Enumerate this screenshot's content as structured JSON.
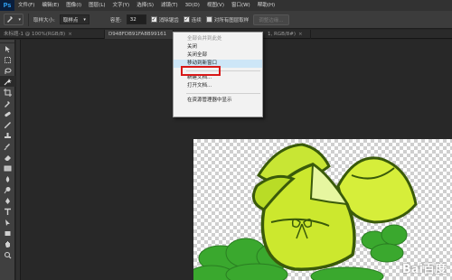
{
  "app": {
    "logo": "Ps"
  },
  "menu": [
    "文件(F)",
    "编辑(E)",
    "图像(I)",
    "图层(L)",
    "文字(Y)",
    "选择(S)",
    "滤镜(T)",
    "3D(D)",
    "视图(V)",
    "窗口(W)",
    "帮助(H)"
  ],
  "options": {
    "sample_size_label": "取样大小:",
    "sample_size_value": "取样点",
    "tolerance_label": "容差:",
    "tolerance_value": "32",
    "antialias_label": "消除锯齿",
    "antialias_checked": true,
    "contiguous_label": "连续",
    "contiguous_checked": true,
    "sample_all_label": "对所有图层取样",
    "sample_all_checked": false,
    "refine_edge_button": "调整边缘..."
  },
  "tabs": [
    {
      "label": "未标题-1 @ 100%(RGB/8)",
      "active": false,
      "close": "×"
    },
    {
      "label": "D948FDB91FA8B99161",
      "active": true,
      "close": ""
    },
    {
      "label": "1, RGB/8#)",
      "active": false,
      "close": "×"
    }
  ],
  "context_menu": {
    "items": [
      {
        "label": "全部合并到此处",
        "disabled": true
      },
      {
        "label": "关闭",
        "disabled": false
      },
      {
        "label": "关闭全部",
        "disabled": false
      },
      {
        "label": "移动到新窗口",
        "disabled": false,
        "highlighted": true
      },
      {
        "label": "新建文档...",
        "disabled": false
      },
      {
        "label": "打开文档...",
        "disabled": false
      },
      {
        "label": "在资源管理器中显示",
        "disabled": false
      }
    ]
  },
  "watermark": "Bai百度",
  "colors": {
    "menu_highlight_border": "#d81818",
    "zongzi_light": "#d6ee3a",
    "zongzi_dark": "#3a5a0a",
    "cloud_green": "#3aa82e"
  }
}
